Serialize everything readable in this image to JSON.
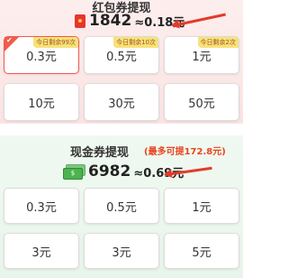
{
  "hongbao": {
    "title": "红包券提现",
    "balance": "1842",
    "approx": "≈0.18元",
    "options": [
      {
        "amount": "0.3元",
        "badge": "今日剩余99次",
        "selected": true
      },
      {
        "amount": "0.5元",
        "badge": "今日剩余10次",
        "selected": false
      },
      {
        "amount": "1元",
        "badge": "今日剩余2次",
        "selected": false
      },
      {
        "amount": "10元",
        "badge": "",
        "selected": false
      },
      {
        "amount": "30元",
        "badge": "",
        "selected": false
      },
      {
        "amount": "50元",
        "badge": "",
        "selected": false
      }
    ]
  },
  "cash": {
    "title": "现金券提现",
    "note": "(最多可提172.8元)",
    "balance": "6982",
    "approx": "≈0.69元",
    "options": [
      {
        "amount": "0.3元"
      },
      {
        "amount": "0.5元"
      },
      {
        "amount": "1元"
      },
      {
        "amount": "3元"
      },
      {
        "amount": "3元"
      },
      {
        "amount": "5元"
      }
    ]
  },
  "colors": {
    "accent": "#f05a4a",
    "arrow": "#e23b2c",
    "badge_bg": "#f7e27a",
    "green": "#4cb34f"
  },
  "icons": {
    "hongbao": "red-envelope-icon",
    "cash": "cash-bills-icon"
  }
}
